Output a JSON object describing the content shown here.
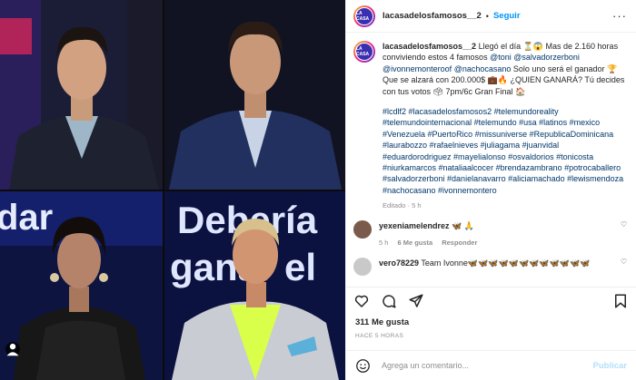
{
  "post": {
    "username": "lacasadelosfamosos__2",
    "follow_label": "Seguir",
    "more_label": "···",
    "avatar_text": "LA CASA",
    "caption_user": "lacasadelosfamosos__2",
    "caption_lines": [
      " Llegó el día ⏳😱 Mas de 2.160 horas conviviendo estos 4 famosos ",
      "@toni",
      " ",
      "@salvadorzerboni",
      " ",
      "@ivonnemonteroof",
      " ",
      "@nachocasano",
      " Solo uno será el ganador 🏆 Que se alzará con 200.000$ 💼🔥 ¿QUIEN GANARÁ? Tú decides con tus votos 🗳 7pm/6c Gran Final 🏠"
    ],
    "hashtags": "#lcdlf2 #lacasadelosfamosos2 #telemundoreality #telemundointernacional #telemundo #usa #latinos #mexico #Venezuela #PuertoRico #missuniverse #RepublicaDominicana #laurabozzo #rafaelnieves #juliagama #juanvidal #eduardorodriguez #mayelialonso #osvaldorios #tonicosta #niurkamarcos #nataliaalcocer #brendazambrano #potrocaballero #salvadorzerboni #danielanavarro #aliciamachado #lewismendoza #nachocasano #ivonnemontero",
    "edited": "Editado · 5 h"
  },
  "comments": [
    {
      "user": "yexeniamelendrez",
      "text": "🦋 🙏",
      "time": "5 h",
      "likes": "6 Me gusta",
      "reply": "Responder",
      "color": "#7a5a4a"
    },
    {
      "user": "vero78229",
      "text": "Team Ivonne🦋🦋🦋🦋🦋🦋🦋🦋🦋🦋🦋🦋",
      "time": "",
      "likes": "",
      "reply": "",
      "color": "#c9c9c9"
    }
  ],
  "likes_label": "311 Me gusta",
  "time_ago": "HACE 5 HORAS",
  "add_comment": {
    "placeholder": "Agrega un comentario...",
    "publish": "Publicar"
  },
  "media_text": {
    "bg_word_top": "Debería",
    "bg_word_bottom": "ganar el",
    "left_bg": "dar"
  },
  "colors": {
    "accent": "#0095f6",
    "link": "#00376b",
    "muted": "#8e8e8e",
    "publish_disabled": "#b2dffc"
  }
}
